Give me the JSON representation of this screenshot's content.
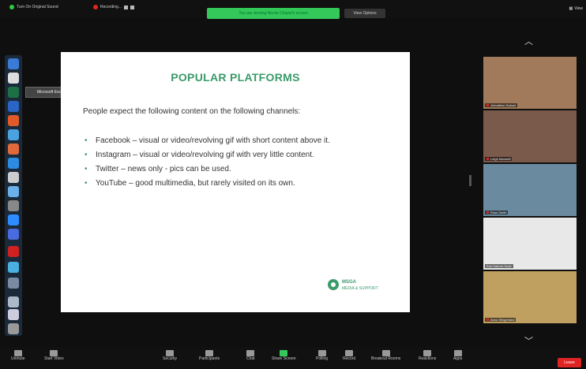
{
  "topbar": {
    "original_sound": "Turn On Original Sound",
    "recording": "Recording...",
    "share_banner": "You are viewing Nicole Chapel's screen",
    "view_options": "View Options",
    "view": "View"
  },
  "tooltip": "Microsoft Excel",
  "slide": {
    "title": "POPULAR PLATFORMS",
    "intro": "People expect the following content on the following channels:",
    "bullets": [
      "Facebook – visual or video/revolving gif with short content above it.",
      "Instagram – visual or video/revolving gif with very little content.",
      "Twitter – news only - pics can be used.",
      "YouTube – good multimedia, but rarely visited on its own."
    ],
    "logo_text": "MSGA MEDIA & SUPPORT"
  },
  "participants": [
    {
      "name": "Johnathan Sahuel",
      "bg": "#a07a5a"
    },
    {
      "name": "Leigh Maxwell",
      "bg": "#7a5a4a"
    },
    {
      "name": "Ross Smith",
      "bg": "#6a8aa0"
    },
    {
      "name": "Earl Sahuel-Toole",
      "bg": "#e8e8e8"
    },
    {
      "name": "Anna Slingerland",
      "bg": "#c0a060"
    }
  ],
  "bottombar": {
    "items": [
      "Unmute",
      "Start Video",
      "Security",
      "Participants",
      "Chat",
      "Share Screen",
      "Polling",
      "Record",
      "Breakout Rooms",
      "Reactions",
      "Apps"
    ],
    "end": "Leave"
  },
  "colors": {
    "accent": "#3a9a6a",
    "share_green": "#34c759",
    "end_red": "#e02424"
  }
}
